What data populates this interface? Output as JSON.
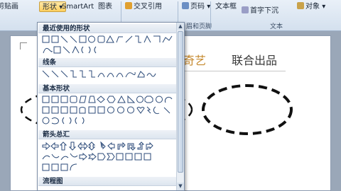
{
  "ribbon": {
    "paste_label": "剪贴画",
    "shapes_label": "形状",
    "smartart_label": "SmartArt",
    "chart_label": "图表",
    "cross_ref_label": "交叉引用",
    "page_number_label": "页码",
    "textbox_label": "文本框",
    "dropcap_label": "首字下沉",
    "object_label": "对象",
    "header_footer_group": "眉和页脚",
    "text_group": "文本",
    "dropdown_arrow": "▾"
  },
  "document": {
    "text_1": "奇艺",
    "text_2": "联合出品"
  },
  "shapes_panel": {
    "sections": [
      {
        "title": "最近使用的形状"
      },
      {
        "title": "线条"
      },
      {
        "title": "基本形状"
      },
      {
        "title": "箭头总汇"
      },
      {
        "title": "流程图"
      }
    ],
    "scroll_up": "▲",
    "scroll_down": "▼"
  },
  "colors": {
    "ribbon_top": "#e9f0f8",
    "ribbon_bottom": "#d4e0ee",
    "active_button": "#ffcf5e",
    "accent_orange": "#c5882c",
    "shape_stroke": "#2b4a78"
  }
}
